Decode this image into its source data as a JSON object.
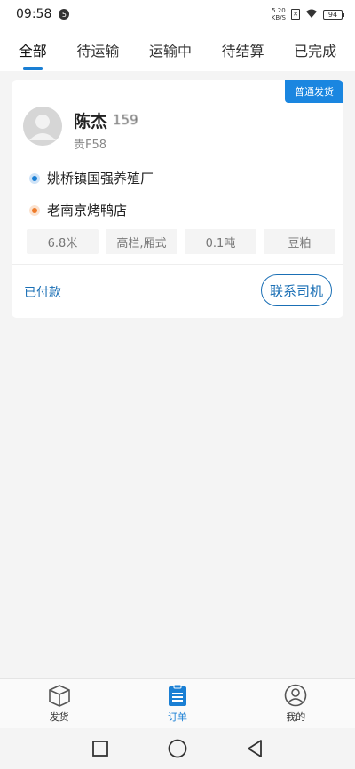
{
  "status_bar": {
    "time": "09:58",
    "notif_count": "5",
    "net_speed_value": "5.20",
    "net_speed_unit": "KB/S",
    "battery": "94"
  },
  "tabs": [
    {
      "label": "全部",
      "active": true
    },
    {
      "label": "待运输",
      "active": false
    },
    {
      "label": "运输中",
      "active": false
    },
    {
      "label": "待结算",
      "active": false
    },
    {
      "label": "已完成",
      "active": false
    }
  ],
  "order": {
    "ship_type": "普通发货",
    "driver_name": "陈杰",
    "driver_phone": "159",
    "plate": "贵F58",
    "from": "姚桥镇国强养殖厂",
    "to": "老南京烤鸭店",
    "tags": [
      "6.8米",
      "高栏,厢式",
      "0.1吨",
      "豆粕"
    ],
    "payment_status": "已付款",
    "contact_label": "联系司机"
  },
  "bottom_nav": [
    {
      "label": "发货",
      "icon": "box-icon",
      "active": false
    },
    {
      "label": "订单",
      "icon": "clipboard-icon",
      "active": true
    },
    {
      "label": "我的",
      "icon": "user-icon",
      "active": false
    }
  ],
  "colors": {
    "accent": "#1a7fd4",
    "orange": "#ee7b2a"
  }
}
